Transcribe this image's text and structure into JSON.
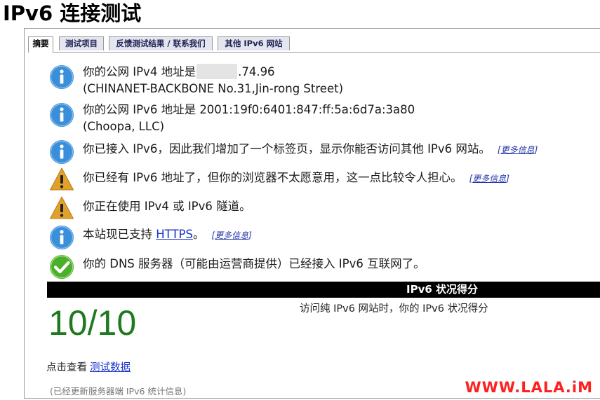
{
  "page": {
    "title": "IPv6 连接测试"
  },
  "tabs": [
    {
      "label": "摘要",
      "active": true
    },
    {
      "label": "测试项目",
      "active": false
    },
    {
      "label": "反馈测试结果 / 联系我们",
      "active": false
    },
    {
      "label": "其他 IPv6 网站",
      "active": false
    }
  ],
  "results": [
    {
      "icon": "info-icon",
      "line1_prefix": "你的公网 IPv4 地址是",
      "line1_suffix": ".74.96",
      "line2": "(CHINANET-BACKBONE No.31,Jin-rong Street)"
    },
    {
      "icon": "info-icon",
      "line1": "你的公网 IPv6 地址是 2001:19f0:6401:847:ff:5a:6d7a:3a80",
      "line2": "(Choopa, LLC)"
    },
    {
      "icon": "info-icon",
      "text": "你已接入 IPv6，因此我们增加了一个标签页，显示你能否访问其他 IPv6 网站。",
      "more": "更多信息"
    },
    {
      "icon": "warning-icon",
      "text": "你已经有 IPv6 地址了，但你的浏览器不太愿意用，这一点比较令人担心。",
      "more": "更多信息"
    },
    {
      "icon": "warning-icon",
      "text": "你正在使用 IPv4 或 IPv6 隧道。"
    },
    {
      "icon": "info-icon",
      "text_before": "本站现已支持 ",
      "link": "HTTPS",
      "text_after": "。",
      "more": "更多信息"
    },
    {
      "icon": "check-icon",
      "text": "你的 DNS 服务器（可能由运营商提供）已经接入 IPv6 互联网了。"
    }
  ],
  "score": {
    "header": "IPv6 状况得分",
    "value": "10/10",
    "caption": "访问纯 IPv6 网站时，你的 IPv6 状况得分"
  },
  "view_data": {
    "prefix": "点击查看",
    "link": "测试数据"
  },
  "footnote": "(已经更新服务器端 IPv6 统计信息)",
  "watermark": "WWW.LALA.iM",
  "colors": {
    "info": "#3b8fd9",
    "warning": "#e0a02a",
    "ok": "#4caf2a",
    "score": "#1f7a1f",
    "link": "#1a33cc",
    "watermark": "#ff1f1f"
  }
}
